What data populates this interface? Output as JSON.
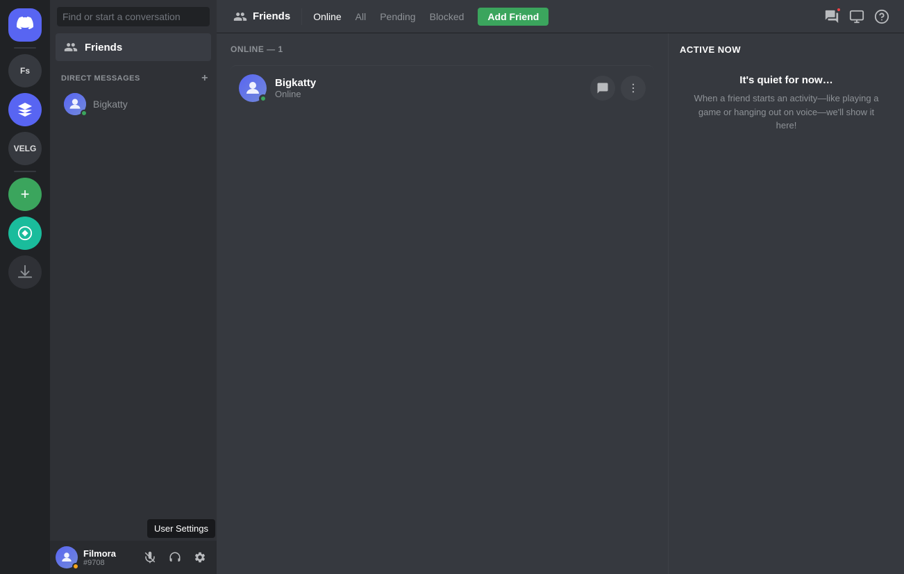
{
  "serverSidebar": {
    "icons": [
      {
        "id": "discord-home",
        "type": "discord",
        "label": "Home"
      },
      {
        "id": "fs-server",
        "type": "text",
        "label": "Fs"
      },
      {
        "id": "nitro-icon",
        "type": "nitro",
        "label": "Nitro"
      },
      {
        "id": "velg-server",
        "type": "text",
        "label": "VELG"
      },
      {
        "id": "add-server",
        "type": "add",
        "label": "Add Server"
      },
      {
        "id": "explore",
        "type": "explore",
        "label": "Explore"
      },
      {
        "id": "download",
        "type": "download",
        "label": "Download Apps"
      }
    ]
  },
  "dmSidebar": {
    "searchPlaceholder": "Find or start a conversation",
    "friendsLabel": "Friends",
    "directMessagesLabel": "DIRECT MESSAGES",
    "addDmLabel": "+",
    "dmList": [
      {
        "id": "bigkatty",
        "name": "Bigkatty",
        "status": "online"
      }
    ]
  },
  "topNav": {
    "friendsLabel": "Friends",
    "tabs": [
      {
        "id": "online",
        "label": "Online",
        "active": true
      },
      {
        "id": "all",
        "label": "All",
        "active": false
      },
      {
        "id": "pending",
        "label": "Pending",
        "active": false
      },
      {
        "id": "blocked",
        "label": "Blocked",
        "active": false
      }
    ],
    "addFriendLabel": "Add Friend",
    "icons": [
      {
        "id": "new-group-dm",
        "label": "New Group DM"
      },
      {
        "id": "inbox",
        "label": "Inbox"
      },
      {
        "id": "help",
        "label": "Help"
      }
    ]
  },
  "friendsList": {
    "onlineHeader": "ONLINE — 1",
    "friends": [
      {
        "id": "bigkatty",
        "name": "Bigkatty",
        "status": "Online"
      }
    ]
  },
  "activeNow": {
    "title": "ACTIVE NOW",
    "quietTitle": "It's quiet for now…",
    "quietDesc": "When a friend starts an activity—like playing a game or hanging out on voice—we'll show it here!"
  },
  "userArea": {
    "name": "Filmora",
    "tag": "#9708",
    "controls": [
      {
        "id": "microphone",
        "label": "Mute"
      },
      {
        "id": "headset",
        "label": "Deafen"
      },
      {
        "id": "settings",
        "label": "User Settings"
      }
    ],
    "tooltip": "User Settings"
  }
}
